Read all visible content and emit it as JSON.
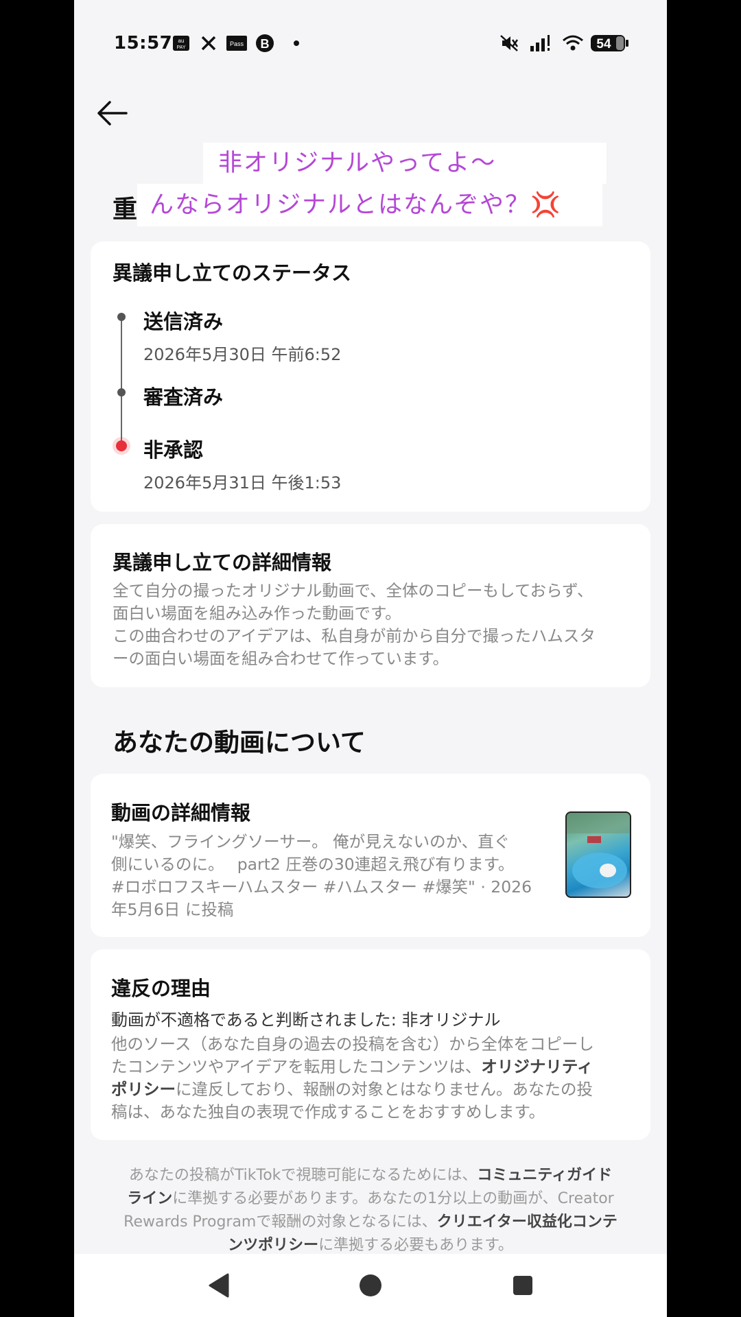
{
  "status_bar": {
    "time": "15:57",
    "battery": "54",
    "left_icons": [
      "aupay-icon",
      "x-icon",
      "pass-icon",
      "b-icon",
      "dot-icon"
    ],
    "right_icons": [
      "mute-icon",
      "signal-icon",
      "wifi-icon",
      "battery-icon"
    ]
  },
  "captions": {
    "line1": "非オリジナルやってよ〜",
    "line2": "んならオリジナルとはなんぞや？💢"
  },
  "page": {
    "title_partial": "重"
  },
  "appeal_status": {
    "title": "異議申し立てのステータス",
    "steps": [
      {
        "label": "送信済み",
        "time": "2026年5月30日 午前6:52"
      },
      {
        "label": "審査済み",
        "time": ""
      },
      {
        "label": "非承認",
        "time": "2026年5月31日 午後1:53"
      }
    ]
  },
  "appeal_details": {
    "title": "異議申し立ての詳細情報",
    "line1": "全て自分の撮ったオリジナル動画で、全体のコピーもしておらず、",
    "line2": "面白い場面を組み込み作った動画です。",
    "line3": "この曲合わせのアイデアは、私自身が前から自分で撮ったハムスタ",
    "line4": "ーの面白い場面を組み合わせて作っています。"
  },
  "video_section": {
    "title": "あなたの動画について",
    "details_title": "動画の詳細情報",
    "line1": "\"爆笑、フライングソーサー。 俺が見えないのか、直ぐ",
    "line2": "側にいるのに。　 part2 圧巻の30連超え飛び有ります。",
    "line3": "#ロボロフスキーハムスター #ハムスター #爆笑\" · 2026",
    "line4": "年5月6日 に投稿"
  },
  "violation": {
    "title": "違反の理由",
    "subtitle": "動画が不適格であると判断されました: 非オリジナル",
    "line1": "他のソース（あなた自身の過去の投稿を含む）から全体をコピーし",
    "line2a": "たコンテンツやアイデアを転用したコンテンツは、",
    "line2b": "オリジナリティ",
    "line3a": "ポリシー",
    "line3b": "に違反しており、報酬の対象とはなりません。あなたの投",
    "line4": "稿は、あなた独自の表現で作成することをおすすめします。"
  },
  "footer": {
    "l1a": "あなたの投稿がTikTokで視聴可能になるためには、",
    "l1b": "コミュニティガイド",
    "l2a": "ライン",
    "l2b": "に準拠する必要があります。あなたの1分以上の動画が、Creator",
    "l3a": "Rewards Programで報酬の対象となるには、",
    "l3b": "クリエイター収益化コンテ",
    "l4a": "ンツポリシー",
    "l4b": "に準拠する必要もあります。"
  },
  "colors": {
    "accent_red": "#e8303a",
    "caption_purple": "#b447d6",
    "background": "#f5f5f7"
  }
}
